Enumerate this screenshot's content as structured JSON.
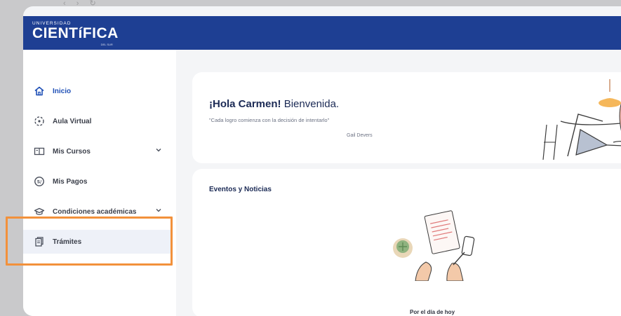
{
  "browser": {
    "nav": "‹ › ↻",
    "url": ""
  },
  "brand": {
    "top": "UNIVERSIDAD",
    "name": "CIENTíFICA",
    "tag": "DEL SUR"
  },
  "sidebar": {
    "items": [
      {
        "label": "Inicio",
        "icon": "home-icon",
        "active": true
      },
      {
        "label": "Aula Virtual",
        "icon": "virtual-classroom-icon"
      },
      {
        "label": "Mis Cursos",
        "icon": "book-icon",
        "expandable": true
      },
      {
        "label": "Mis Pagos",
        "icon": "payment-icon"
      },
      {
        "label": "Condiciones académicas",
        "icon": "graduation-cap-icon",
        "expandable": true
      },
      {
        "label": "Trámites",
        "icon": "documents-icon",
        "selected": true
      }
    ]
  },
  "welcome": {
    "greeting_name": "¡Hola Carmen!",
    "greeting_rest": " Bienvenida.",
    "quote": "\"Cada logro comienza con la decisión de intentarlo\"",
    "author": "Gail Devers"
  },
  "events": {
    "title": "Eventos y Noticias",
    "empty_caption": "Por el día de hoy"
  },
  "colors": {
    "topbar": "#1e3f93",
    "accent": "#1e4fb6",
    "highlight": "#f2913b",
    "background": "#c9c9cb"
  }
}
